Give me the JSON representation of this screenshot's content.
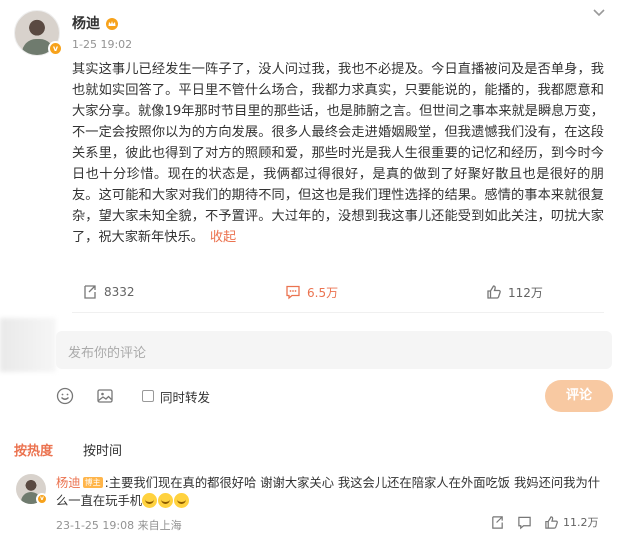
{
  "post": {
    "author": "杨迪",
    "time": "1-25 19:02",
    "text": "其实这事儿已经发生一阵子了，没人问过我，我也不必提及。今日直播被问及是否单身，我也就如实回答了。平日里不管什么场合，我都力求真实，只要能说的，能播的，我都愿意和大家分享。就像19年那时节目里的那些话，也是肺腑之言。但世间之事本来就是瞬息万变，不一定会按照你以为的方向发展。很多人最终会走进婚姻殿堂，但我遗憾我们没有，在这段关系里，彼此也得到了对方的照顾和爱，那些时光是我人生很重要的记忆和经历，到今时今日也十分珍惜。现在的状态是，我俩都过得很好，是真的做到了好聚好散且也是很好的朋友。这可能和大家对我们的期待不同，但这也是我们理性选择的结果。感情的事本来就很复杂，望大家未知全貌，不予置评。大过年的，没想到我这事儿还能受到如此关注，叨扰大家了，祝大家新年快乐。",
    "collapse_label": "收起",
    "repost_count": "8332",
    "comment_count": "6.5万",
    "like_count": "112万"
  },
  "composer": {
    "placeholder": "发布你的评论",
    "also_repost_label": "同时转发",
    "submit_label": "评论"
  },
  "sort": {
    "hot_label": "按热度",
    "time_label": "按时间"
  },
  "comment": {
    "name": "杨迪",
    "tag": "博主",
    "separator": ":",
    "text": "主要我们现在真的都很好哈 谢谢大家关心 我这会儿还在陪家人在外面吃饭 我妈还问我为什么一直在玩手机",
    "meta": "23-1-25 19:08 来自上海",
    "like_count": "11.2万"
  },
  "colors": {
    "accent": "#eb7350",
    "submit_disabled": "#f8c9a2",
    "verified_badge": "#f7a21b"
  },
  "icons": [
    "crown-icon",
    "more-icon",
    "repost-icon",
    "comment-icon",
    "like-icon",
    "emoji-icon",
    "image-icon",
    "share-icon",
    "reply-icon",
    "laugh-cry-emoji"
  ]
}
